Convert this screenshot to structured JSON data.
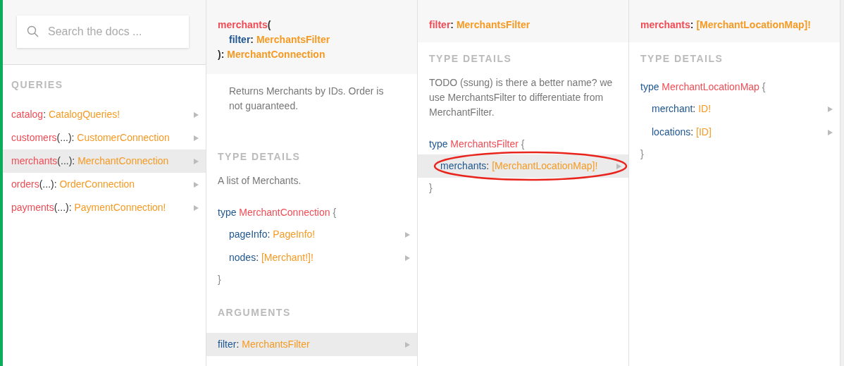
{
  "search": {
    "placeholder": "Search the docs ..."
  },
  "queries": {
    "heading": "QUERIES",
    "items": [
      {
        "parts": [
          {
            "name": "catalog"
          },
          {
            "punct": ": "
          },
          {
            "type": "CatalogQueries!"
          }
        ],
        "selected": false
      },
      {
        "parts": [
          {
            "name": "customers"
          },
          {
            "punct": "(...): "
          },
          {
            "type": "CustomerConnection"
          }
        ],
        "selected": false
      },
      {
        "parts": [
          {
            "name": "merchants"
          },
          {
            "punct": "(...): "
          },
          {
            "type": "MerchantConnection"
          }
        ],
        "selected": true
      },
      {
        "parts": [
          {
            "name": "orders"
          },
          {
            "punct": "(...): "
          },
          {
            "type": "OrderConnection"
          }
        ],
        "selected": false
      },
      {
        "parts": [
          {
            "name": "payments"
          },
          {
            "punct": "(...): "
          },
          {
            "type": "PaymentConnection!"
          }
        ],
        "selected": false
      }
    ]
  },
  "panels": [
    {
      "title": {
        "parts": [
          {
            "name": "merchants"
          },
          {
            "punct": "("
          }
        ],
        "args": [
          {
            "parts": [
              {
                "field": "filter"
              },
              {
                "punct": ": "
              },
              {
                "type": "MerchantsFilter"
              }
            ]
          }
        ],
        "close": [
          {
            "punct": "): "
          },
          {
            "type": "MerchantConnection"
          }
        ]
      },
      "description": "Returns Merchants by IDs. Order is not guaranteed.",
      "sections": [
        {
          "heading": "TYPE DETAILS",
          "description": "A list of Merchants.",
          "type_block": {
            "keyword": "type",
            "name": "MerchantConnection",
            "open": "{",
            "close": "}",
            "fields": [
              {
                "parts": [
                  {
                    "field": "pageInfo"
                  },
                  {
                    "punct": ": "
                  },
                  {
                    "type": "PageInfo!"
                  }
                ],
                "selected": false,
                "circled": false
              },
              {
                "parts": [
                  {
                    "field": "nodes"
                  },
                  {
                    "punct": ": "
                  },
                  {
                    "type": "[Merchant!]!"
                  }
                ],
                "selected": false,
                "circled": false
              }
            ]
          }
        },
        {
          "heading": "ARGUMENTS",
          "rows": [
            {
              "parts": [
                {
                  "field": "filter"
                },
                {
                  "punct": ": "
                },
                {
                  "type": "MerchantsFilter"
                }
              ],
              "selected": true
            }
          ]
        }
      ]
    },
    {
      "title": {
        "parts": [
          {
            "name": "filter"
          },
          {
            "punct": ": "
          },
          {
            "type": "MerchantsFilter"
          }
        ]
      },
      "sections": [
        {
          "heading": "TYPE DETAILS",
          "description": "TODO (ssung) is there a better name? we use MerchantsFilter to differentiate from MerchantFilter.",
          "type_block": {
            "keyword": "type",
            "name": "MerchantsFilter",
            "open": "{",
            "close": "}",
            "fields": [
              {
                "parts": [
                  {
                    "field": "merchants"
                  },
                  {
                    "punct": ": "
                  },
                  {
                    "type": "[MerchantLocationMap]!"
                  }
                ],
                "selected": true,
                "circled": true
              }
            ]
          }
        }
      ]
    },
    {
      "title": {
        "parts": [
          {
            "name": "merchants"
          },
          {
            "punct": ": "
          },
          {
            "type": "[MerchantLocationMap]!"
          }
        ]
      },
      "sections": [
        {
          "heading": "TYPE DETAILS",
          "type_block": {
            "keyword": "type",
            "name": "MerchantLocationMap",
            "open": "{",
            "close": "}",
            "fields": [
              {
                "parts": [
                  {
                    "field": "merchant"
                  },
                  {
                    "punct": ": "
                  },
                  {
                    "type": "ID!"
                  }
                ],
                "selected": false,
                "circled": false
              },
              {
                "parts": [
                  {
                    "field": "locations"
                  },
                  {
                    "punct": ": "
                  },
                  {
                    "type": "[ID]"
                  }
                ],
                "selected": false,
                "circled": false
              }
            ]
          }
        }
      ]
    }
  ]
}
